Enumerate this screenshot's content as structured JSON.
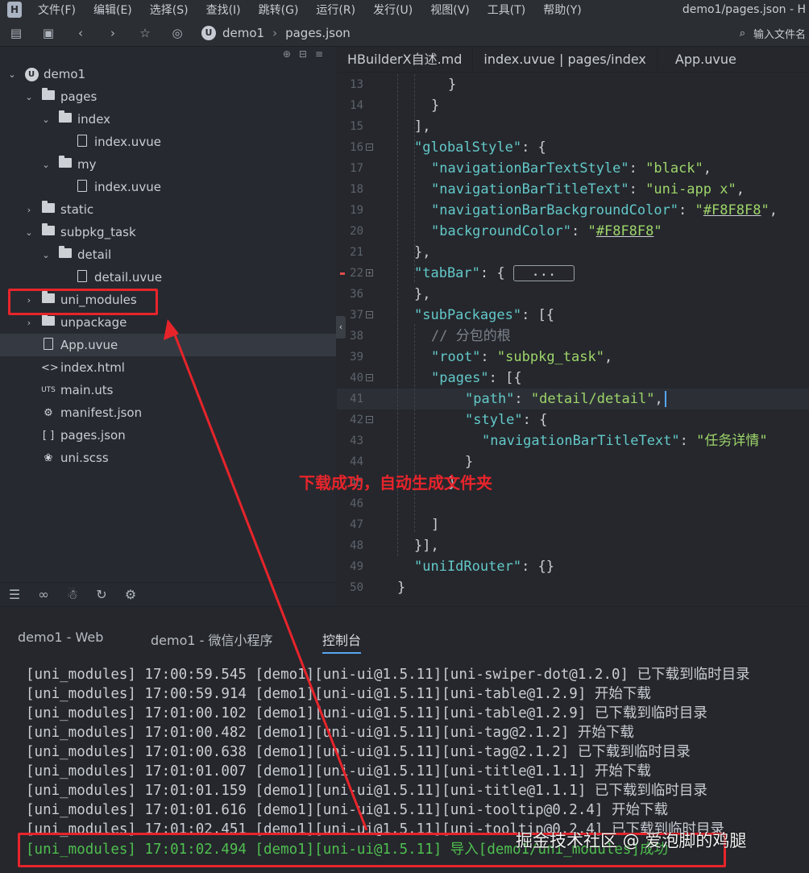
{
  "menubar": {
    "items": [
      "文件(F)",
      "编辑(E)",
      "选择(S)",
      "查找(I)",
      "跳转(G)",
      "运行(R)",
      "发行(U)",
      "视图(V)",
      "工具(T)",
      "帮助(Y)"
    ],
    "window_title": "demo1/pages.json - H"
  },
  "toolbar": {
    "breadcrumb": [
      "demo1",
      "pages.json"
    ],
    "search_placeholder": "输入文件名"
  },
  "sidebar": {
    "tree": [
      {
        "label": "demo1",
        "type": "root",
        "depth": 0,
        "expanded": true
      },
      {
        "label": "pages",
        "type": "folder",
        "depth": 1,
        "expanded": true
      },
      {
        "label": "index",
        "type": "folder",
        "depth": 2,
        "expanded": true
      },
      {
        "label": "index.uvue",
        "type": "file",
        "depth": 3
      },
      {
        "label": "my",
        "type": "folder",
        "depth": 2,
        "expanded": true
      },
      {
        "label": "index.uvue",
        "type": "file",
        "depth": 3
      },
      {
        "label": "static",
        "type": "folder",
        "depth": 1,
        "expanded": false
      },
      {
        "label": "subpkg_task",
        "type": "folder",
        "depth": 1,
        "expanded": true
      },
      {
        "label": "detail",
        "type": "folder",
        "depth": 2,
        "expanded": true
      },
      {
        "label": "detail.uvue",
        "type": "file",
        "depth": 3
      },
      {
        "label": "uni_modules",
        "type": "folder",
        "depth": 1,
        "expanded": false
      },
      {
        "label": "unpackage",
        "type": "folder",
        "depth": 1,
        "expanded": false
      },
      {
        "label": "App.uvue",
        "type": "file",
        "depth": 1,
        "selected": true
      },
      {
        "label": "index.html",
        "type": "html",
        "depth": 1
      },
      {
        "label": "main.uts",
        "type": "uts",
        "depth": 1
      },
      {
        "label": "manifest.json",
        "type": "manifest",
        "depth": 1
      },
      {
        "label": "pages.json",
        "type": "pages",
        "depth": 1
      },
      {
        "label": "uni.scss",
        "type": "scss",
        "depth": 1
      }
    ],
    "uts_badge": "UTS",
    "pages_badge": "[ ]",
    "html_badge": "<>"
  },
  "editor": {
    "tabs": [
      "HBuilderX自述.md",
      "index.uvue | pages/index",
      "App.uvue"
    ],
    "lines": [
      {
        "n": "13",
        "fold": false,
        "indent": 4,
        "parts": [
          [
            "p",
            "}"
          ]
        ]
      },
      {
        "n": "14",
        "fold": false,
        "indent": 3,
        "parts": [
          [
            "p",
            "}"
          ]
        ]
      },
      {
        "n": "15",
        "fold": false,
        "indent": 2,
        "parts": [
          [
            "p",
            "],"
          ]
        ]
      },
      {
        "n": "16",
        "fold": true,
        "indent": 2,
        "parts": [
          [
            "k",
            "\"globalStyle\""
          ],
          [
            "p",
            ": {"
          ]
        ]
      },
      {
        "n": "17",
        "fold": false,
        "indent": 3,
        "parts": [
          [
            "k",
            "\"navigationBarTextStyle\""
          ],
          [
            "p",
            ": "
          ],
          [
            "s",
            "\"black\""
          ],
          [
            "p",
            ","
          ]
        ]
      },
      {
        "n": "18",
        "fold": false,
        "indent": 3,
        "parts": [
          [
            "k",
            "\"navigationBarTitleText\""
          ],
          [
            "p",
            ": "
          ],
          [
            "s",
            "\"uni-app x\""
          ],
          [
            "p",
            ","
          ]
        ]
      },
      {
        "n": "19",
        "fold": false,
        "indent": 3,
        "parts": [
          [
            "k",
            "\"navigationBarBackgroundColor\""
          ],
          [
            "p",
            ": "
          ],
          [
            "s",
            "\""
          ],
          [
            "su",
            "#F8F8F8"
          ],
          [
            "s",
            "\""
          ],
          [
            "p",
            ","
          ]
        ]
      },
      {
        "n": "20",
        "fold": false,
        "indent": 3,
        "parts": [
          [
            "k",
            "\"backgroundColor\""
          ],
          [
            "p",
            ": "
          ],
          [
            "s",
            "\""
          ],
          [
            "su",
            "#F8F8F8"
          ],
          [
            "s",
            "\""
          ]
        ]
      },
      {
        "n": "21",
        "fold": false,
        "indent": 2,
        "parts": [
          [
            "p",
            "},"
          ]
        ]
      },
      {
        "n": "22",
        "fold": true,
        "err": true,
        "indent": 2,
        "parts": [
          [
            "k",
            "\"tabBar\""
          ],
          [
            "p",
            ": { "
          ],
          [
            "box",
            "..."
          ]
        ]
      },
      {
        "n": "36",
        "fold": false,
        "indent": 2,
        "parts": [
          [
            "p",
            "},"
          ]
        ]
      },
      {
        "n": "37",
        "fold": true,
        "indent": 2,
        "parts": [
          [
            "k",
            "\"subPackages\""
          ],
          [
            "p",
            ": [{"
          ]
        ]
      },
      {
        "n": "38",
        "fold": false,
        "indent": 3,
        "parts": [
          [
            "c",
            "// 分包的根"
          ]
        ]
      },
      {
        "n": "39",
        "fold": false,
        "indent": 3,
        "parts": [
          [
            "k",
            "\"root\""
          ],
          [
            "p",
            ": "
          ],
          [
            "s",
            "\"subpkg_task\""
          ],
          [
            "p",
            ","
          ]
        ]
      },
      {
        "n": "40",
        "fold": true,
        "indent": 3,
        "parts": [
          [
            "k",
            "\"pages\""
          ],
          [
            "p",
            ": [{"
          ]
        ]
      },
      {
        "n": "41",
        "fold": false,
        "indent": 5,
        "active": true,
        "parts": [
          [
            "k",
            "\"path\""
          ],
          [
            "p",
            ": "
          ],
          [
            "s",
            "\"detail/detail\""
          ],
          [
            "p",
            ","
          ],
          [
            "cursor",
            ""
          ]
        ]
      },
      {
        "n": "42",
        "fold": true,
        "indent": 5,
        "parts": [
          [
            "k",
            "\"style\""
          ],
          [
            "p",
            ": {"
          ]
        ]
      },
      {
        "n": "43",
        "fold": false,
        "indent": 6,
        "parts": [
          [
            "k",
            "\"navigationBarTitleText\""
          ],
          [
            "p",
            ": "
          ],
          [
            "s",
            "\"任务详情\""
          ]
        ]
      },
      {
        "n": "44",
        "fold": false,
        "indent": 5,
        "parts": [
          [
            "p",
            "}"
          ]
        ]
      },
      {
        "n": "45",
        "fold": false,
        "indent": 4,
        "parts": [
          [
            "p",
            "}"
          ]
        ]
      },
      {
        "n": "46",
        "fold": false,
        "indent": 0,
        "parts": []
      },
      {
        "n": "47",
        "fold": false,
        "indent": 3,
        "parts": [
          [
            "p",
            "]"
          ]
        ]
      },
      {
        "n": "48",
        "fold": false,
        "indent": 2,
        "parts": [
          [
            "p",
            "}],"
          ]
        ]
      },
      {
        "n": "49",
        "fold": false,
        "indent": 2,
        "parts": [
          [
            "k",
            "\"uniIdRouter\""
          ],
          [
            "p",
            ": {}"
          ]
        ]
      },
      {
        "n": "50",
        "fold": false,
        "indent": 1,
        "parts": [
          [
            "p",
            "}"
          ]
        ]
      }
    ]
  },
  "console": {
    "tabs": [
      "demo1 - Web",
      "demo1 - 微信小程序",
      "控制台"
    ],
    "active_tab": 2,
    "lines": [
      "[uni_modules] 17:00:59.545 [demo1][uni-ui@1.5.11][uni-swiper-dot@1.2.0] 已下载到临时目录",
      "[uni_modules] 17:00:59.914 [demo1][uni-ui@1.5.11][uni-table@1.2.9] 开始下载",
      "[uni_modules] 17:01:00.102 [demo1][uni-ui@1.5.11][uni-table@1.2.9] 已下载到临时目录",
      "[uni_modules] 17:01:00.482 [demo1][uni-ui@1.5.11][uni-tag@2.1.2] 开始下载",
      "[uni_modules] 17:01:00.638 [demo1][uni-ui@1.5.11][uni-tag@2.1.2] 已下载到临时目录",
      "[uni_modules] 17:01:01.007 [demo1][uni-ui@1.5.11][uni-title@1.1.1] 开始下载",
      "[uni_modules] 17:01:01.159 [demo1][uni-ui@1.5.11][uni-title@1.1.1] 已下载到临时目录",
      "[uni_modules] 17:01:01.616 [demo1][uni-ui@1.5.11][uni-tooltip@0.2.4] 开始下载",
      "[uni_modules] 17:01:02.451 [demo1][uni-ui@1.5.11][uni-tooltip@0.2.4] 已下载到临时目录"
    ],
    "success_line": "[uni_modules] 17:01:02.494 [demo1][uni-ui@1.5.11] 导入[demo1/uni_modules]成功"
  },
  "annotation": {
    "text": "下载成功，自动生成文件夹",
    "color": "#e8242b"
  },
  "watermark": "掘金技术社区 @ 爱泡脚的鸡腿",
  "colors": {
    "key": "#63c8c9",
    "string": "#9ed56a",
    "success": "#4fbf4f",
    "accent": "#5aa6f0"
  }
}
